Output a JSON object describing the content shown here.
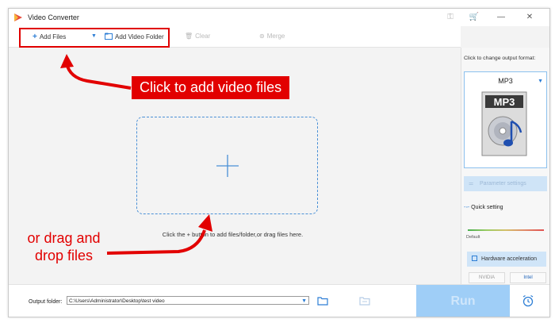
{
  "window": {
    "title": "Video Converter"
  },
  "titlebar_icons": [
    "key-icon",
    "cart-icon"
  ],
  "window_controls": {
    "minimize": "—",
    "close": "✕"
  },
  "toolbar": {
    "add_files": "Add Files",
    "add_video_folder": "Add Video Folder",
    "clear": "Clear",
    "merge": "Merge"
  },
  "annotations": {
    "click_callout": "Click to add video files",
    "drag_line1": "or drag and",
    "drag_line2": "drop files"
  },
  "main": {
    "drop_hint": "Click the + button to add files/folder,or drag files here."
  },
  "right_panel": {
    "hint": "Click to change output format:",
    "format": "MP3",
    "parameter_settings": "Parameter settings",
    "quick_setting": "Quick setting",
    "slider_label": "Default",
    "hardware_acceleration": "Hardware acceleration",
    "vendors": [
      "NVIDIA",
      "Intel"
    ]
  },
  "bottom": {
    "output_label": "Output folder:",
    "output_path": "C:\\Users\\Administrator\\Desktop\\test video",
    "run": "Run"
  },
  "colors": {
    "accent": "#2d7ed5",
    "annotation_red": "#e20000",
    "run": "#9fcef7"
  }
}
